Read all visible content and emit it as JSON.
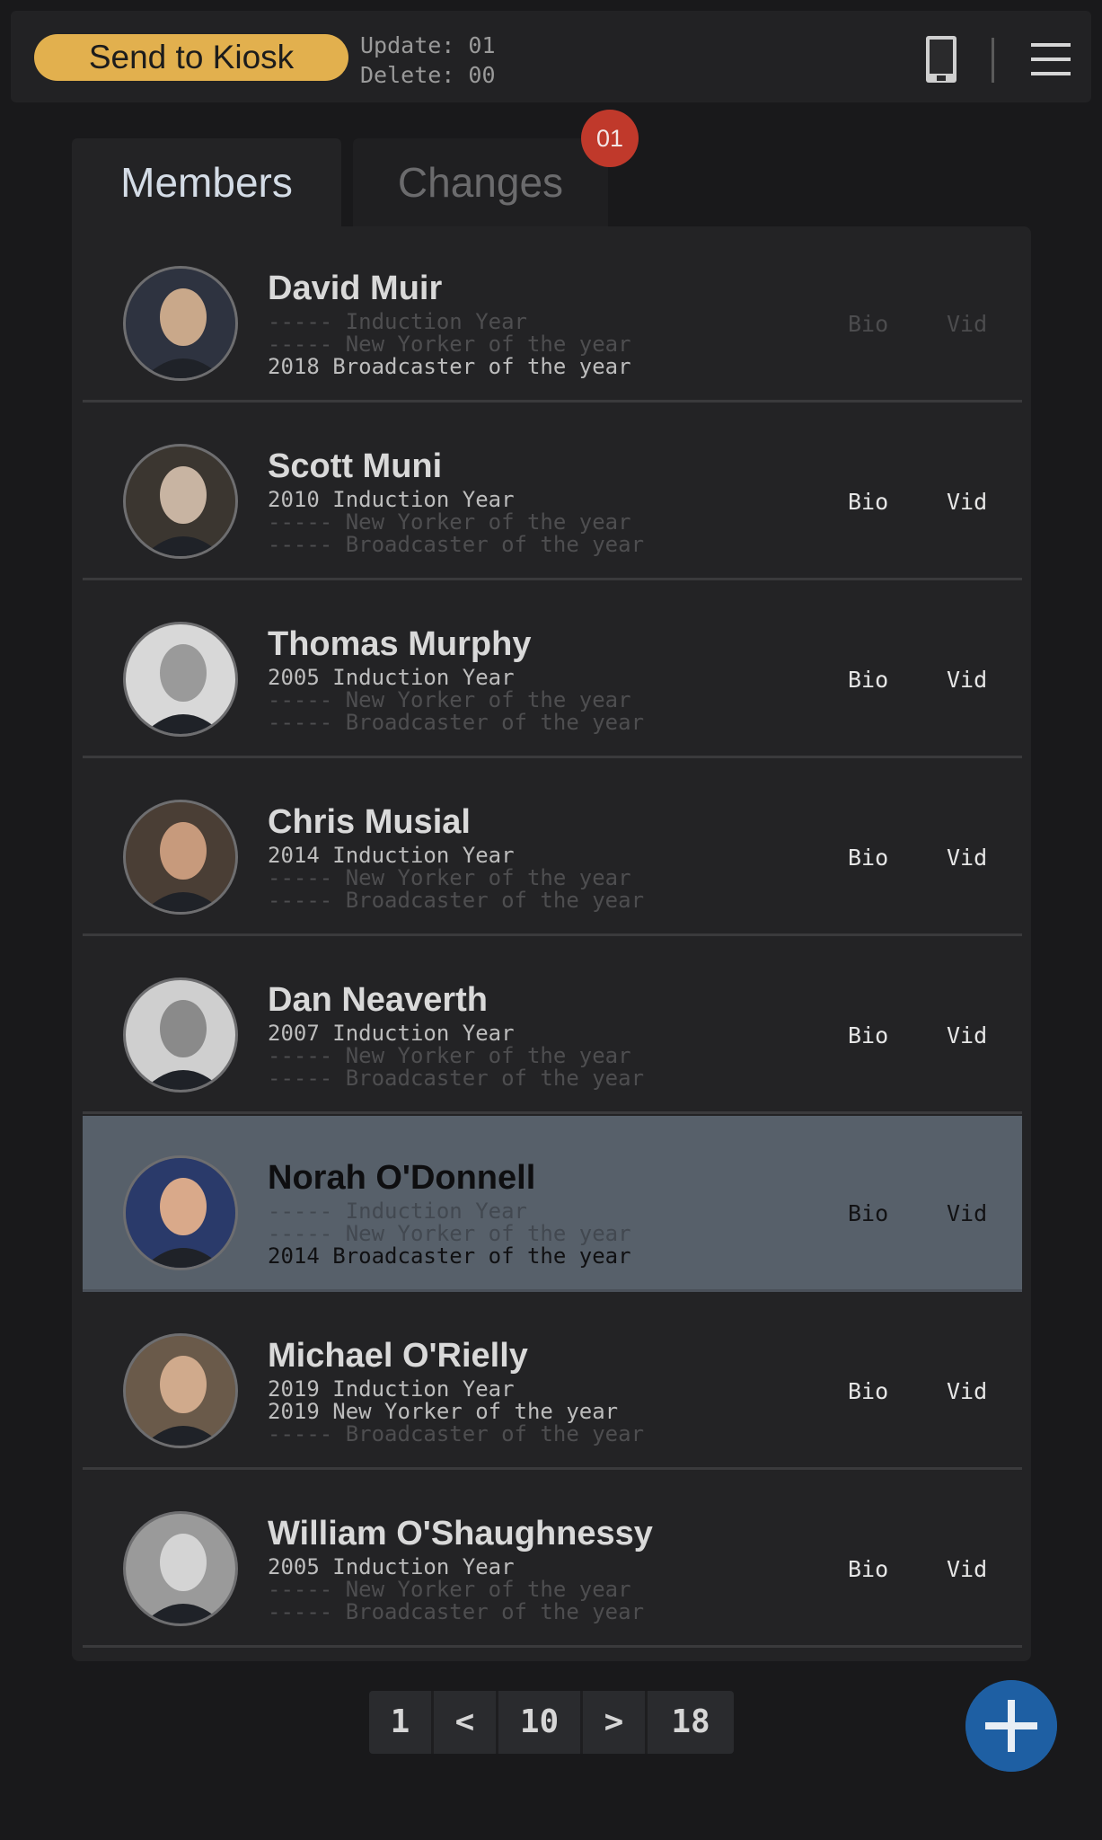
{
  "topbar": {
    "send_label": "Send to Kiosk",
    "update_text": "Update: 01",
    "delete_text": "Delete: 00"
  },
  "tabs": {
    "members": "Members",
    "changes": "Changes",
    "changes_badge": "01"
  },
  "members": [
    {
      "name": "David Muir",
      "lines": [
        "----- Induction Year",
        "----- New Yorker of the year",
        "2018 Broadcaster of the year"
      ],
      "active": [
        false,
        false,
        true
      ],
      "bio": "Bio",
      "vid": "Vid",
      "links_enabled": false,
      "selected": false
    },
    {
      "name": "Scott Muni",
      "lines": [
        "2010 Induction Year",
        "----- New Yorker of the year",
        "----- Broadcaster of the year"
      ],
      "active": [
        true,
        false,
        false
      ],
      "bio": "Bio",
      "vid": "Vid",
      "links_enabled": true,
      "selected": false
    },
    {
      "name": "Thomas Murphy",
      "lines": [
        "2005 Induction Year",
        "----- New Yorker of the year",
        "----- Broadcaster of the year"
      ],
      "active": [
        true,
        false,
        false
      ],
      "bio": "Bio",
      "vid": "Vid",
      "links_enabled": true,
      "selected": false
    },
    {
      "name": "Chris Musial",
      "lines": [
        "2014 Induction Year",
        "----- New Yorker of the year",
        "----- Broadcaster of the year"
      ],
      "active": [
        true,
        false,
        false
      ],
      "bio": "Bio",
      "vid": "Vid",
      "links_enabled": true,
      "selected": false
    },
    {
      "name": "Dan Neaverth",
      "lines": [
        "2007 Induction Year",
        "----- New Yorker of the year",
        "----- Broadcaster of the year"
      ],
      "active": [
        true,
        false,
        false
      ],
      "bio": "Bio",
      "vid": "Vid",
      "links_enabled": true,
      "selected": false
    },
    {
      "name": "Norah O'Donnell",
      "lines": [
        "----- Induction Year",
        "----- New Yorker of the year",
        "2014 Broadcaster of the year"
      ],
      "active": [
        false,
        false,
        true
      ],
      "bio": "Bio",
      "vid": "Vid",
      "links_enabled": true,
      "selected": true
    },
    {
      "name": "Michael O'Rielly",
      "lines": [
        "2019 Induction Year",
        "2019 New Yorker of the year",
        "----- Broadcaster of the year"
      ],
      "active": [
        true,
        true,
        false
      ],
      "bio": "Bio",
      "vid": "Vid",
      "links_enabled": true,
      "selected": false
    },
    {
      "name": "William O'Shaughnessy",
      "lines": [
        "2005 Induction Year",
        "----- New Yorker of the year",
        "----- Broadcaster of the year"
      ],
      "active": [
        true,
        false,
        false
      ],
      "bio": "Bio",
      "vid": "Vid",
      "links_enabled": true,
      "selected": false
    }
  ],
  "pagination": {
    "first": "1",
    "prev": "<",
    "current": "10",
    "next": ">",
    "last": "18"
  },
  "icons": {
    "send": "send-to-kiosk",
    "tablet": "tablet-icon",
    "menu": "hamburger-menu-icon",
    "add": "plus-icon"
  },
  "colors": {
    "accent": "#e2b04e",
    "badge": "#c0392b",
    "fab": "#1e5fa3",
    "selected_row": "#57606a"
  }
}
